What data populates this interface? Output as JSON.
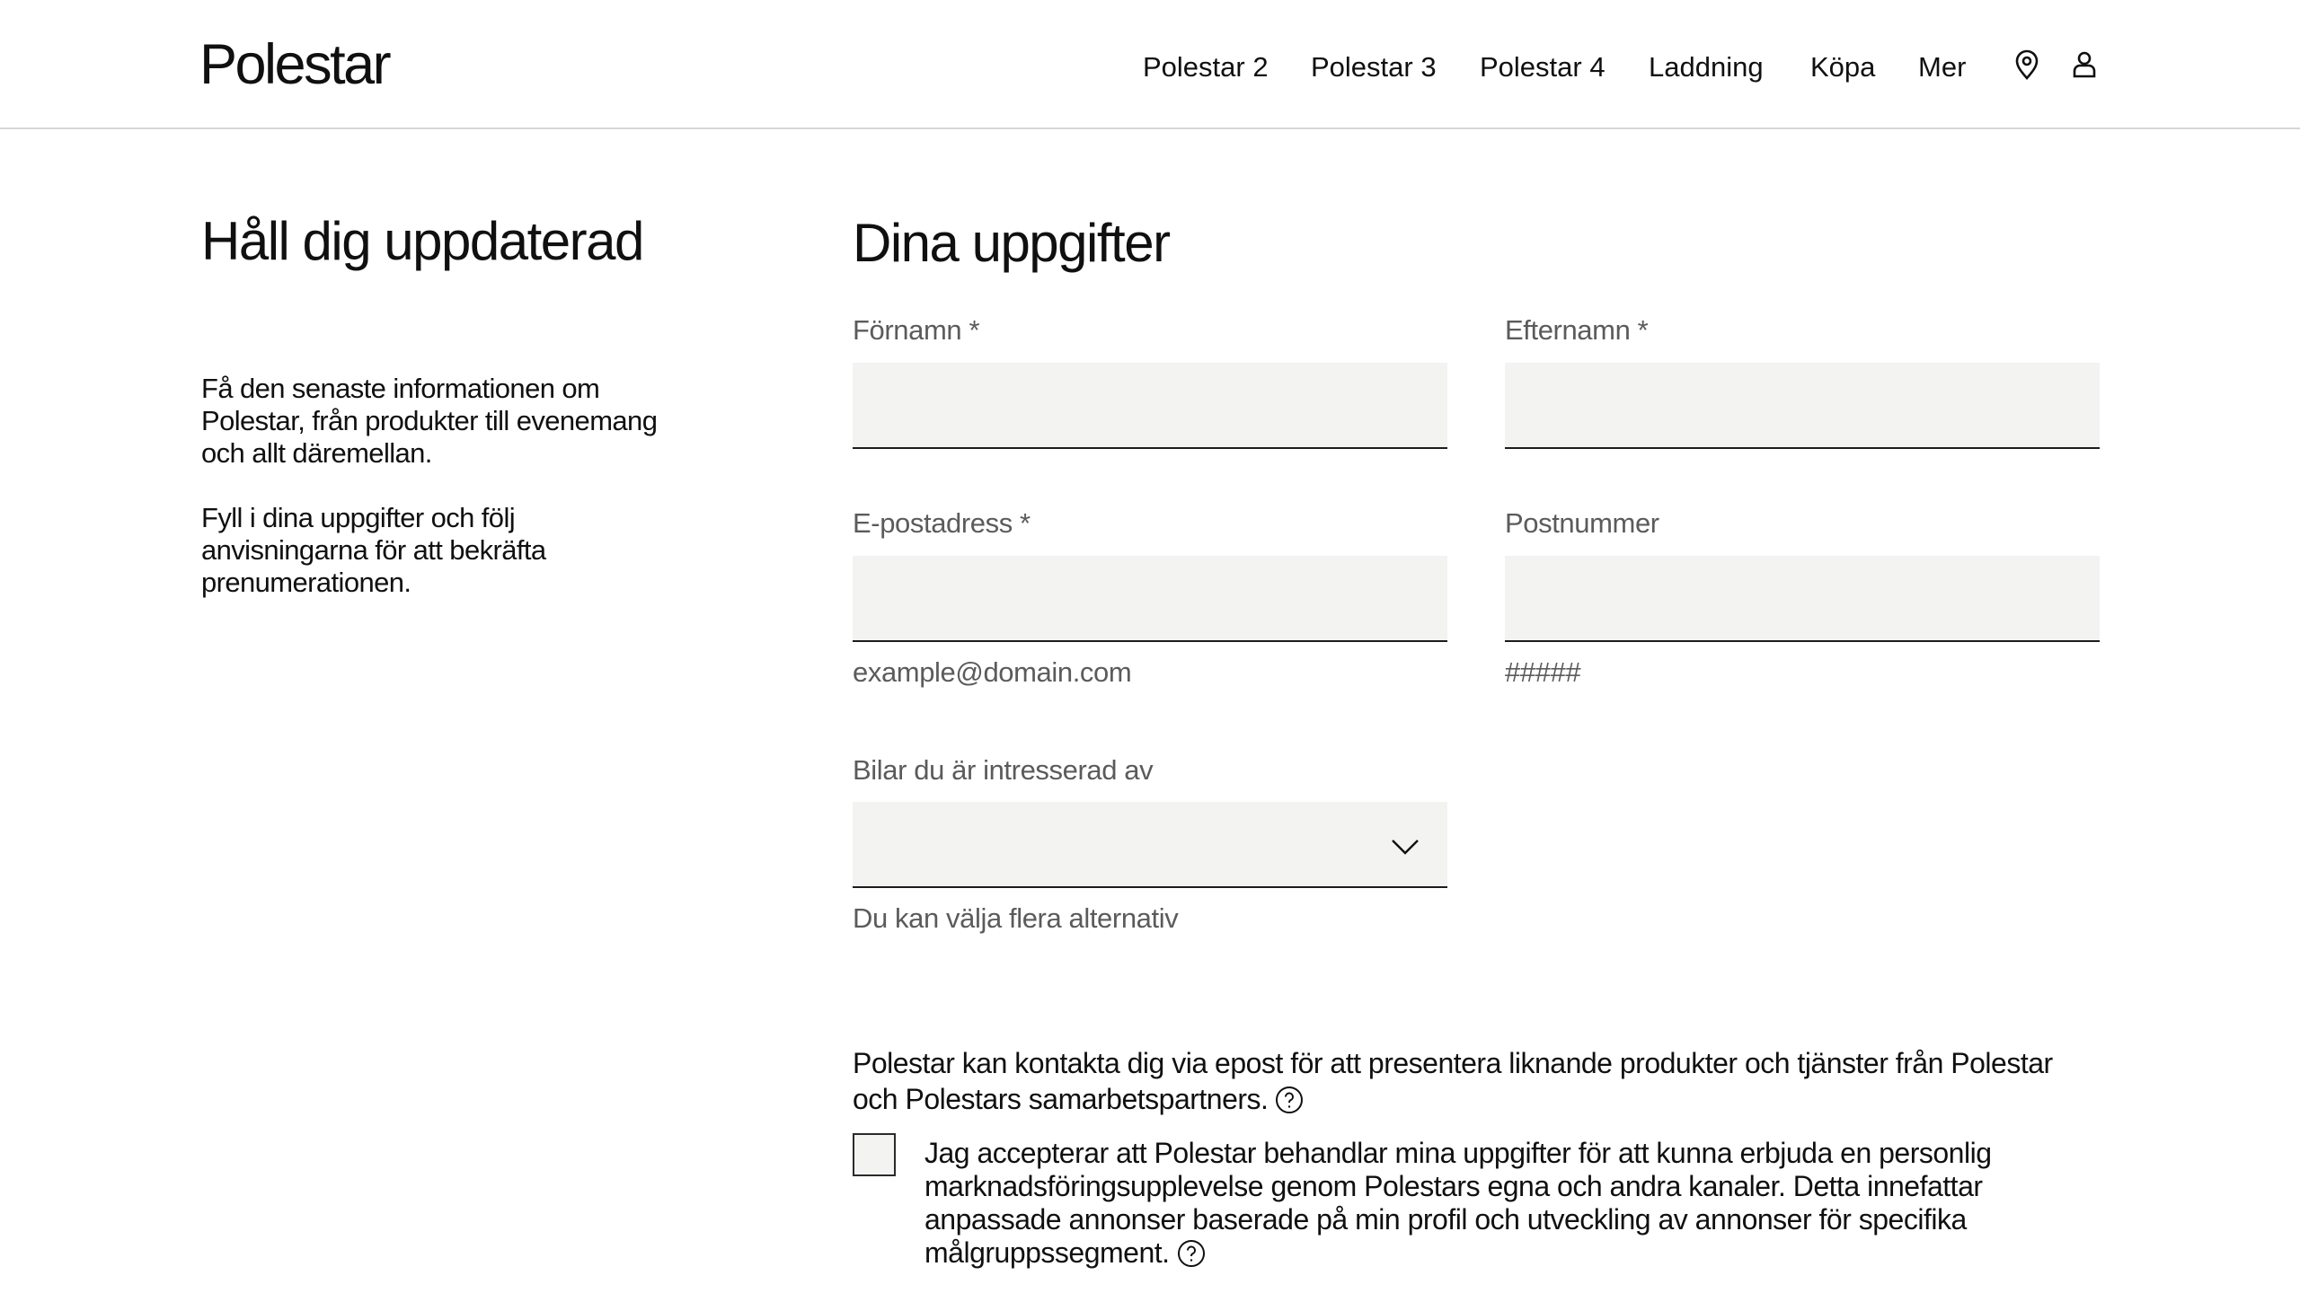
{
  "header": {
    "logo": "Polestar",
    "nav": [
      "Polestar 2",
      "Polestar 3",
      "Polestar 4",
      "Laddning",
      "Köpa",
      "Mer"
    ],
    "icons": [
      "location-pin-icon",
      "user-account-icon"
    ]
  },
  "intro": {
    "title": "Håll dig uppdaterad",
    "paragraph1": "Få den senaste informationen om Polestar, från produkter till evenemang och allt däremellan.",
    "paragraph2": "Fyll i dina uppgifter och följ anvisningarna för att bekräfta prenumerationen."
  },
  "form": {
    "title": "Dina uppgifter",
    "first_name": {
      "label": "Förnamn *",
      "value": ""
    },
    "last_name": {
      "label": "Efternamn *",
      "value": ""
    },
    "email": {
      "label": "E-postadress *",
      "value": "",
      "hint": "example@domain.com"
    },
    "postal_code": {
      "label": "Postnummer",
      "value": "",
      "hint": "#####"
    },
    "cars": {
      "label": "Bilar du är intresserad av",
      "value": "",
      "hint": "Du kan välja flera alternativ"
    }
  },
  "consent": {
    "text": "Polestar kan kontakta dig via epost för att presentera liknande produkter och tjänster från Polestar och Polestars samarbetspartners.",
    "checkbox_label": "Jag accepterar att Polestar behandlar mina uppgifter för att kunna erbjuda en personlig marknadsföringsupplevelse genom Polestars egna och andra kanaler. Detta innefattar anpassade annonser baserade på min profil och utveckling av annonser för specifika målgruppssegment.",
    "checked": false
  },
  "colors": {
    "text": "#101010",
    "label": "#5b5b5b",
    "field_background": "#f3f3f2",
    "divider": "#d6d6d6"
  }
}
